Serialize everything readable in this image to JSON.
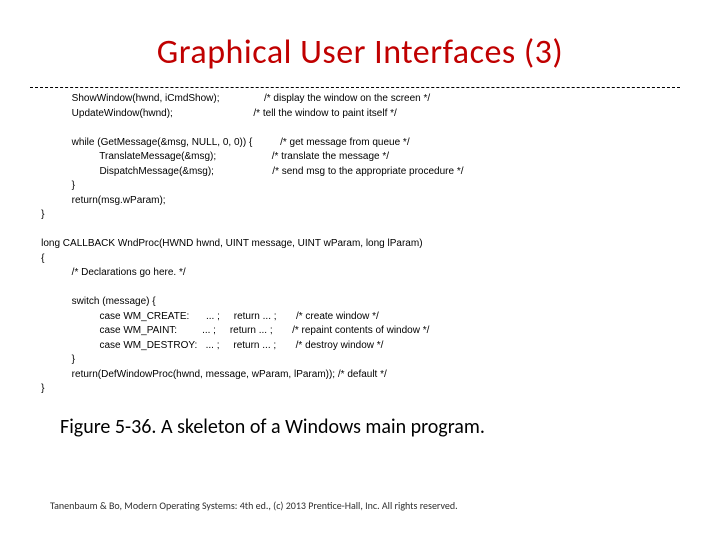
{
  "title": "Graphical User Interfaces (3)",
  "code": "               ShowWindow(hwnd, iCmdShow);                /* display the window on the screen */\n               UpdateWindow(hwnd);                             /* tell the window to paint itself */\n\n               while (GetMessage(&msg, NULL, 0, 0)) {          /* get message from queue */\n                         TranslateMessage(&msg);                    /* translate the message */\n                         DispatchMessage(&msg);                     /* send msg to the appropriate procedure */\n               }\n               return(msg.wParam);\n    }\n\n    long CALLBACK WndProc(HWND hwnd, UINT message, UINT wParam, long lParam)\n    {\n               /* Declarations go here. */\n\n               switch (message) {\n                         case WM_CREATE:      ... ;     return ... ;       /* create window */\n                         case WM_PAINT:         ... ;     return ... ;       /* repaint contents of window */\n                         case WM_DESTROY:   ... ;     return ... ;       /* destroy window */\n               }\n               return(DefWindowProc(hwnd, message, wParam, lParam)); /* default */\n    }",
  "caption": "Figure 5-36. A skeleton of a Windows main program.",
  "footer": "Tanenbaum & Bo, Modern Operating Systems: 4th ed., (c) 2013 Prentice-Hall, Inc. All rights reserved."
}
